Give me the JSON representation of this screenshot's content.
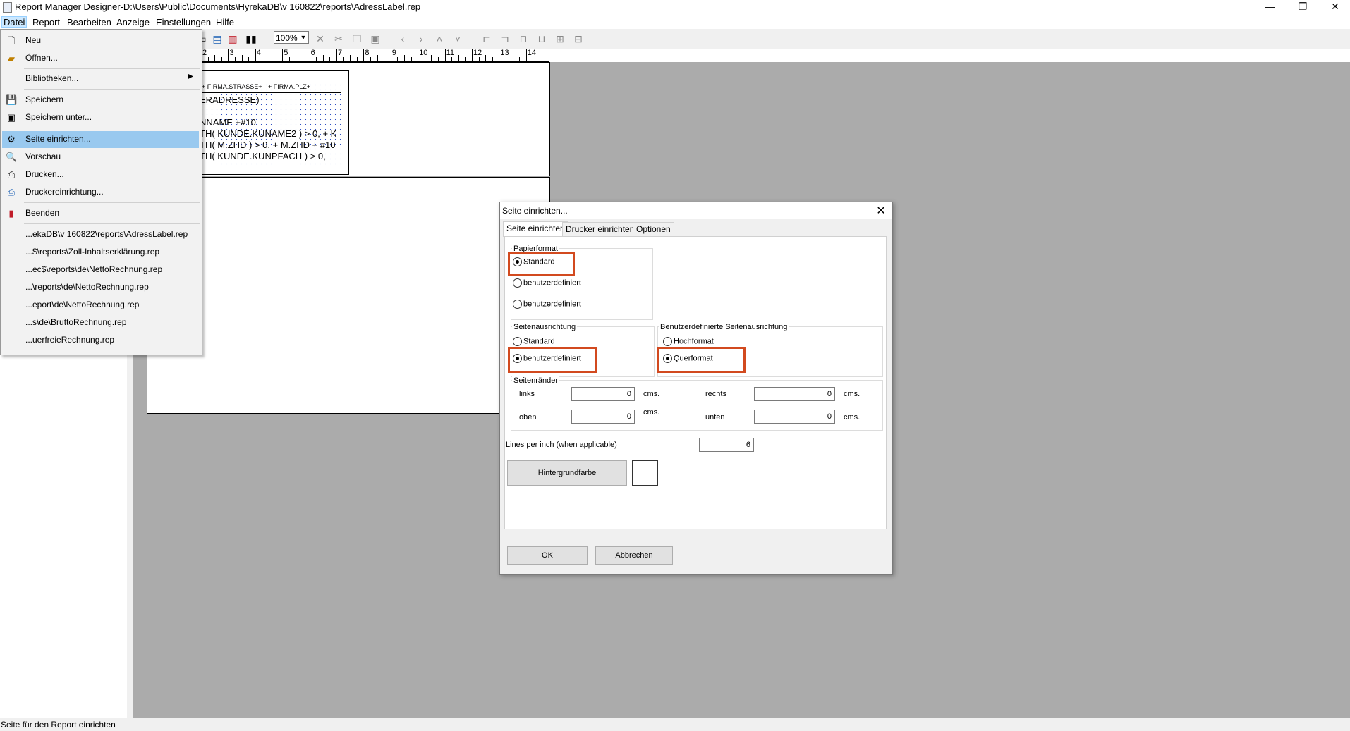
{
  "window": {
    "title": "Report Manager Designer-D:\\Users\\Public\\Documents\\HyrekaDB\\v 160822\\reports\\AdressLabel.rep",
    "minimize": "—",
    "maximize": "❐",
    "close": "✕"
  },
  "menubar": {
    "items": [
      "Datei",
      "Report",
      "Bearbeiten",
      "Anzeige",
      "Einstellungen",
      "Hilfe"
    ]
  },
  "toolbar": {
    "zoom": "100%"
  },
  "ruler": {
    "labels": [
      "2",
      "3",
      "4",
      "5",
      "6",
      "7",
      "8",
      "9",
      "10",
      "11",
      "12",
      "13",
      "14"
    ]
  },
  "report": {
    "header_line": "·+ FIRMA.STRASSE+· ·+ FIRMA.PLZ+·",
    "lines": [
      "ERADRESSE)",
      "",
      "NNAME +#10",
      "TH( KUNDE.KUNAME2 ) > 0, + K",
      "TH( M.ZHD ) > 0, + M.ZHD + #10",
      "TH( KUNDE.KUNPFACH ) > 0,"
    ]
  },
  "file_menu": {
    "items": [
      {
        "label": "Neu",
        "icon": "new-file-icon"
      },
      {
        "label": "Öffnen...",
        "icon": "open-folder-icon"
      },
      {
        "label": "Bibliotheken...",
        "icon": "",
        "submenu": true
      },
      {
        "label": "Speichern",
        "icon": "save-icon"
      },
      {
        "label": "Speichern unter...",
        "icon": "save-as-icon"
      },
      {
        "label": "Seite einrichten...",
        "icon": "page-setup-icon",
        "highlighted": true
      },
      {
        "label": "Vorschau",
        "icon": "preview-icon"
      },
      {
        "label": "Drucken...",
        "icon": "print-icon"
      },
      {
        "label": "Druckereinrichtung...",
        "icon": "printer-setup-icon"
      },
      {
        "label": "Beenden",
        "icon": "exit-icon"
      }
    ],
    "recent": [
      "...ekaDB\\v 160822\\reports\\AdressLabel.rep",
      "...$\\reports\\Zoll-Inhaltserklärung.rep",
      "...ec$\\reports\\de\\NettoRechnung.rep",
      "...\\reports\\de\\NettoRechnung.rep",
      "...eport\\de\\NettoRechnung.rep",
      "...s\\de\\BruttoRechnung.rep",
      "...uerfreieRechnung.rep"
    ]
  },
  "dialog": {
    "title": "Seite einrichten...",
    "close": "✕",
    "tabs": [
      "Seite einrichten",
      "Drucker einrichten",
      "Optionen"
    ],
    "papierformat": {
      "label": "Papierformat",
      "options": [
        "Standard",
        "benutzerdefiniert",
        "benutzerdefiniert"
      ],
      "selected": 0
    },
    "seitenausrichtung": {
      "label": "Seitenausrichtung",
      "options": [
        "Standard",
        "benutzerdefiniert"
      ],
      "selected": 1
    },
    "benutzer_ausrichtung": {
      "label": "Benutzerdefinierte Seitenausrichtung",
      "options": [
        "Hochformat",
        "Querformat"
      ],
      "selected": 1
    },
    "seitenraender": {
      "label": "Seitenränder",
      "links_label": "links",
      "links_value": "0",
      "oben_label": "oben",
      "oben_value": "0",
      "rechts_label": "rechts",
      "rechts_value": "0",
      "unten_label": "unten",
      "unten_value": "0",
      "unit": "cms."
    },
    "lpi_label": "Lines per inch (when applicable)",
    "lpi_value": "6",
    "bg_button": "Hintergrundfarbe",
    "ok": "OK",
    "cancel": "Abbrechen"
  },
  "status": {
    "text": "Seite für den Report einrichten"
  },
  "colors": {
    "highlight_box": "#d24a1f",
    "menu_highlight": "#99c9ef",
    "workspace": "#ababab"
  }
}
